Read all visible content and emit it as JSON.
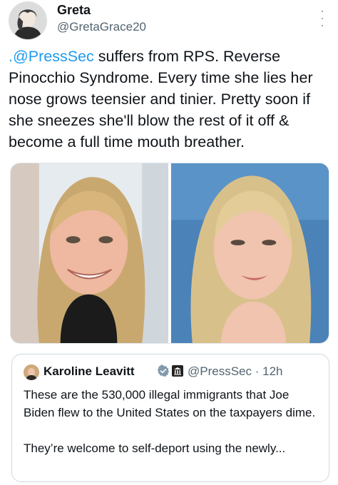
{
  "author": {
    "display_name": "Greta",
    "handle": "@GretaGrace20",
    "avatar_icon": "profile-photo"
  },
  "tweet": {
    "mention": ".@PressSec",
    "text": " suffers from RPS. Reverse Pinocchio Syndrome. Every time she lies her nose grows teensier and tinier. Pretty soon if she sneezes she'll blow the rest of it off & become a full time mouth breather."
  },
  "media": {
    "count": 2
  },
  "quoted": {
    "display_name": "Karoline Leavitt",
    "handle_time": "@PressSec · 12h",
    "line1": "These are the 530,000 illegal immigrants that Joe Biden flew to the United States on the taxpayers dime.",
    "line2": "They’re welcome to self-deport using the newly..."
  },
  "colors": {
    "accent": "#1d9bf0",
    "secondary_text": "#536471"
  },
  "icons": {
    "more": "more-vertical-icon",
    "verified": "verified-badge-icon",
    "government": "government-building-icon"
  }
}
